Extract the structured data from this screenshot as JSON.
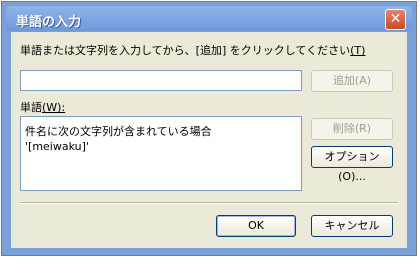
{
  "dialog": {
    "title": "単語の入力",
    "close_glyph": "✕"
  },
  "prompt": {
    "text": "単語または文字列を入力してから、[追加] をクリックしてください",
    "accelerator": "(T)"
  },
  "word_input": {
    "value": "",
    "placeholder": ""
  },
  "buttons": {
    "add": "追加(A)",
    "delete": "削除(R)",
    "options": "オプション(O)...",
    "ok": "OK",
    "cancel": "キャンセル"
  },
  "words_list": {
    "label": "単語",
    "accelerator": "(W):",
    "lines": [
      "件名に次の文字列が含まれている場合",
      "'[meiwaku]'"
    ]
  }
}
